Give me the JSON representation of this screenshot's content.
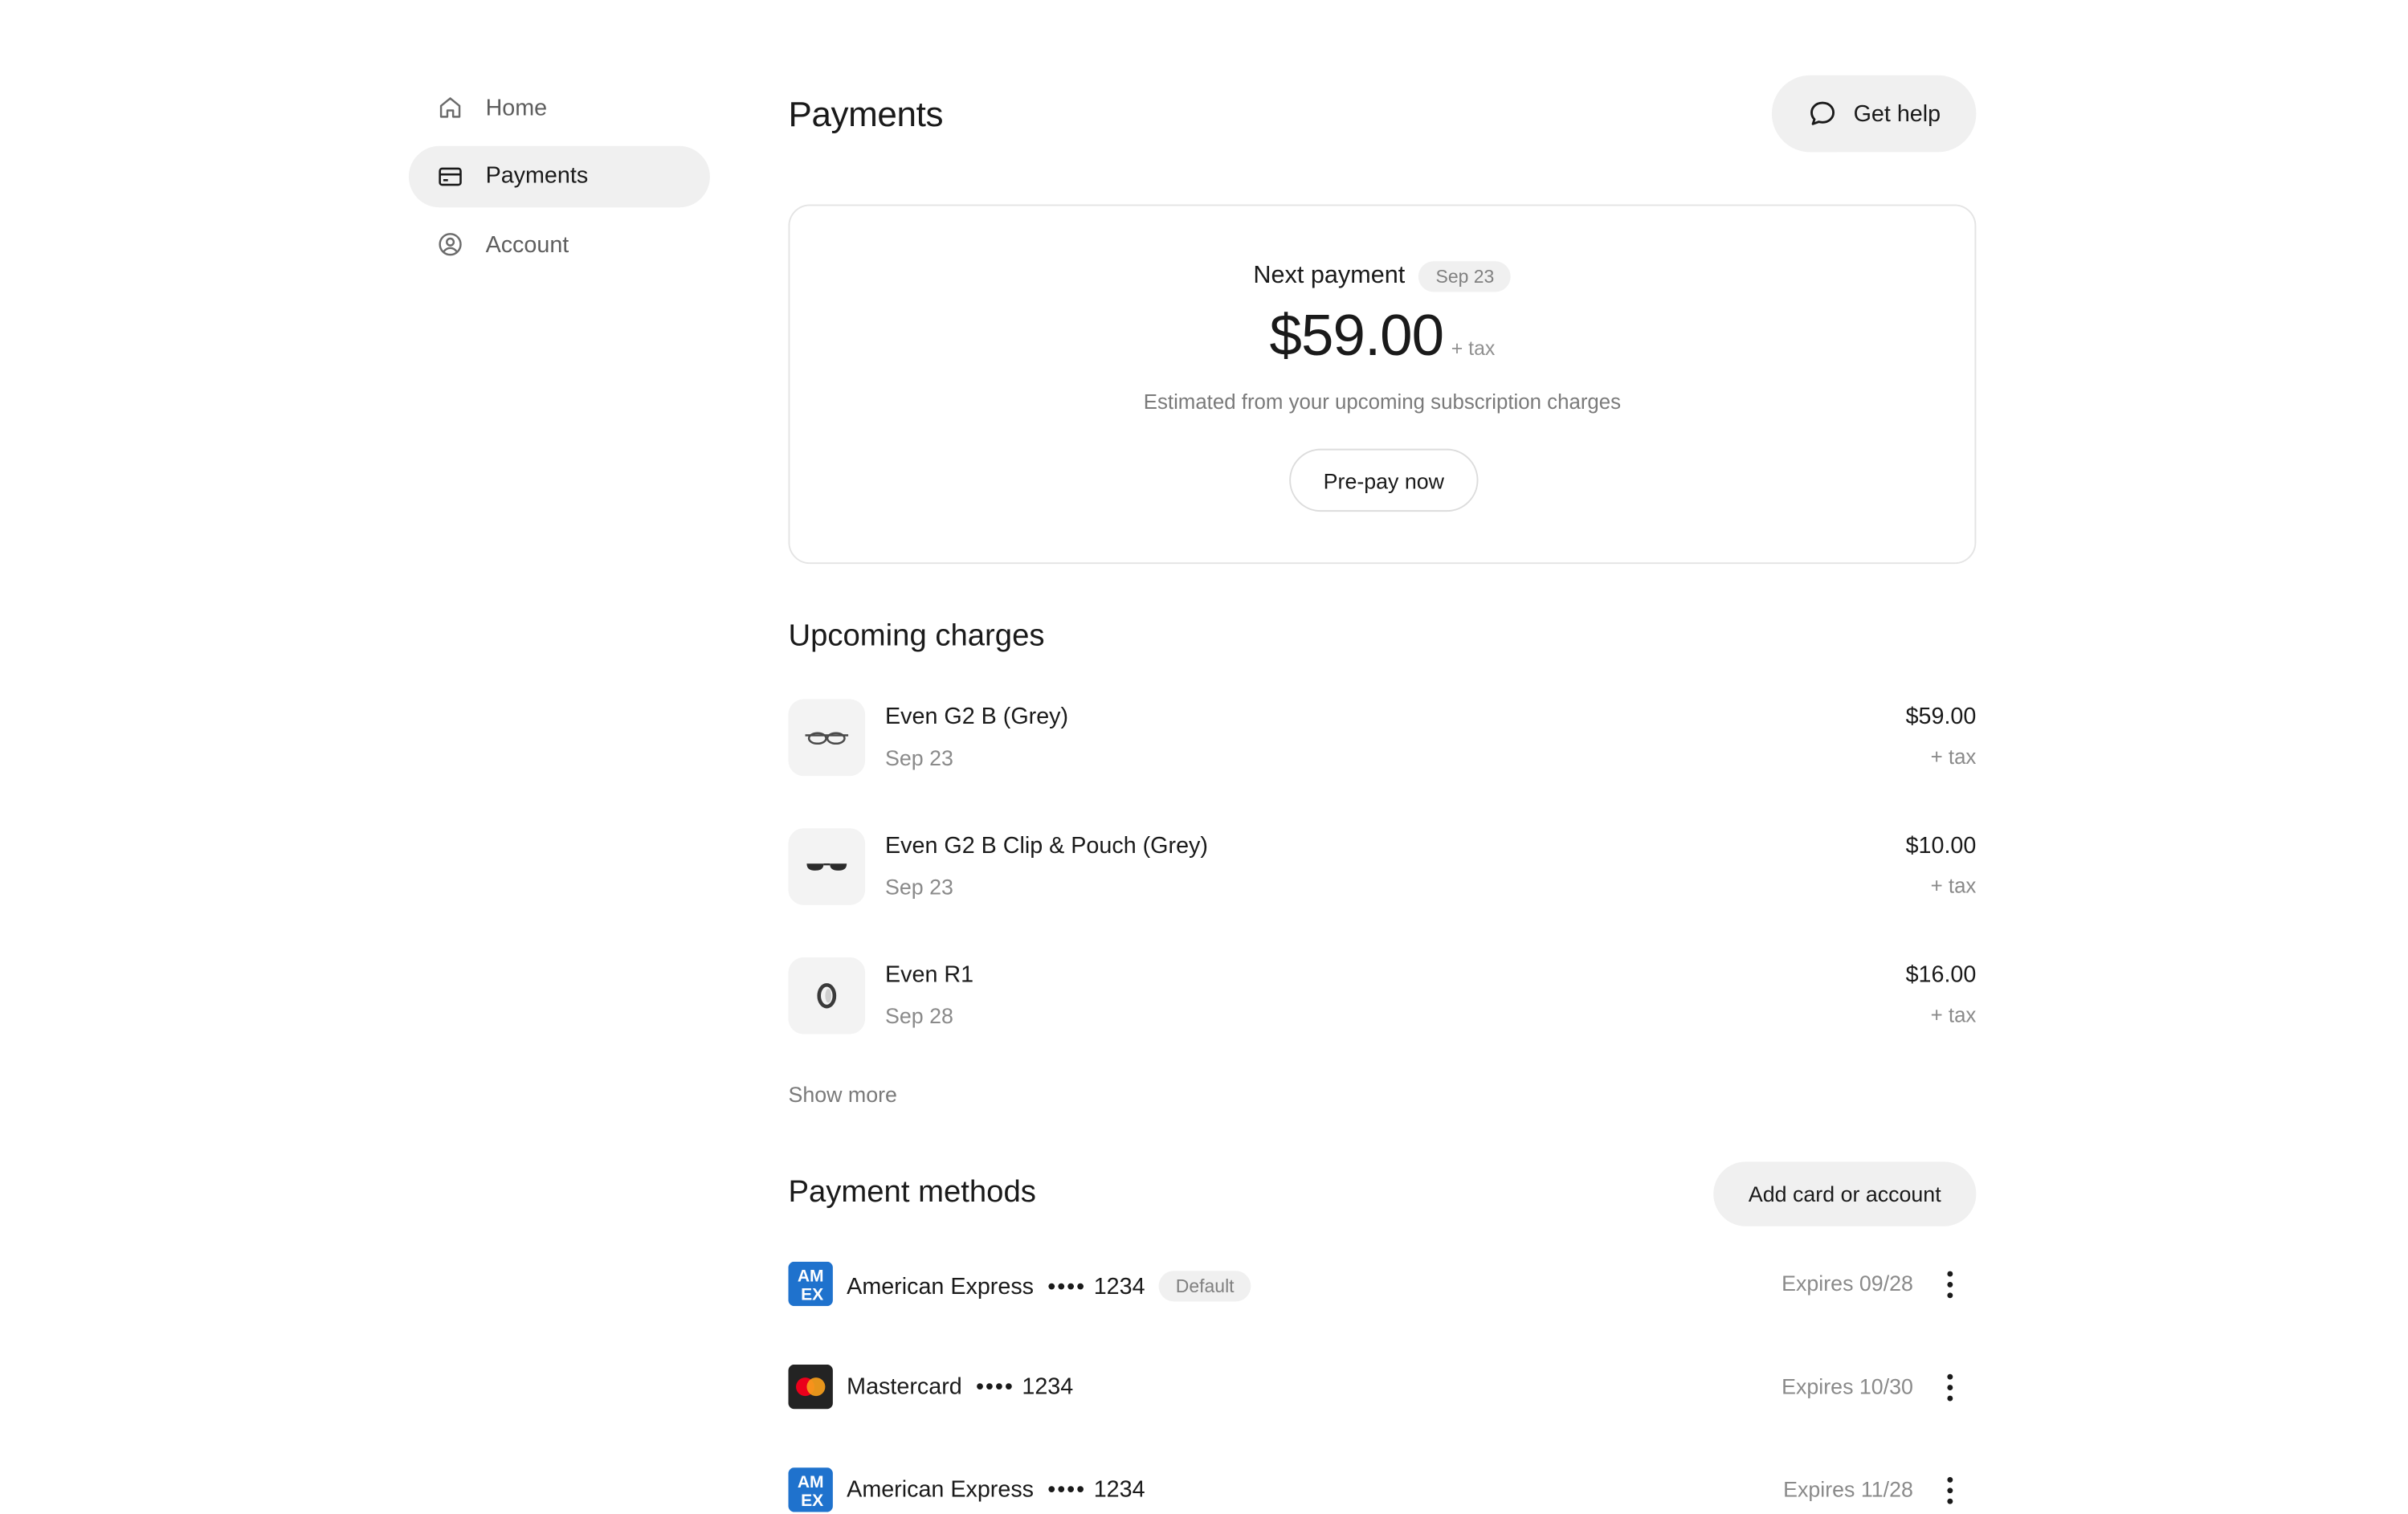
{
  "sidebar": {
    "items": [
      {
        "label": "Home",
        "icon": "home-icon",
        "active": false
      },
      {
        "label": "Payments",
        "icon": "credit-card-icon",
        "active": true
      },
      {
        "label": "Account",
        "icon": "user-circle-icon",
        "active": false
      }
    ]
  },
  "header": {
    "title": "Payments",
    "help_label": "Get help"
  },
  "next_payment": {
    "label": "Next payment",
    "date": "Sep 23",
    "amount": "$59.00",
    "tax": "+ tax",
    "note": "Estimated from your upcoming subscription charges",
    "prepay_label": "Pre-pay now"
  },
  "upcoming": {
    "title": "Upcoming charges",
    "items": [
      {
        "name": "Even G2 B (Grey)",
        "date": "Sep 23",
        "amount": "$59.00",
        "tax": "+ tax"
      },
      {
        "name": "Even G2 B Clip & Pouch (Grey)",
        "date": "Sep 23",
        "amount": "$10.00",
        "tax": "+ tax"
      },
      {
        "name": "Even R1",
        "date": "Sep 28",
        "amount": "$16.00",
        "tax": "+ tax"
      }
    ],
    "show_more": "Show more"
  },
  "payment_methods": {
    "title": "Payment methods",
    "add_label": "Add card or account",
    "items": [
      {
        "brand": "American Express",
        "dots": "••••",
        "last4": "1234",
        "badge": "Default",
        "expires": "Expires 09/28"
      },
      {
        "brand": "Mastercard",
        "dots": "••••",
        "last4": "1234",
        "expires": "Expires 10/30"
      },
      {
        "brand": "American Express",
        "dots": "••••",
        "last4": "1234",
        "expires": "Expires 11/28"
      }
    ]
  },
  "colors": {
    "amex_blue": "#1f72cd",
    "mastercard_bg": "#232323",
    "mastercard_red": "#eb001b",
    "mastercard_orange": "#f79e1b"
  }
}
